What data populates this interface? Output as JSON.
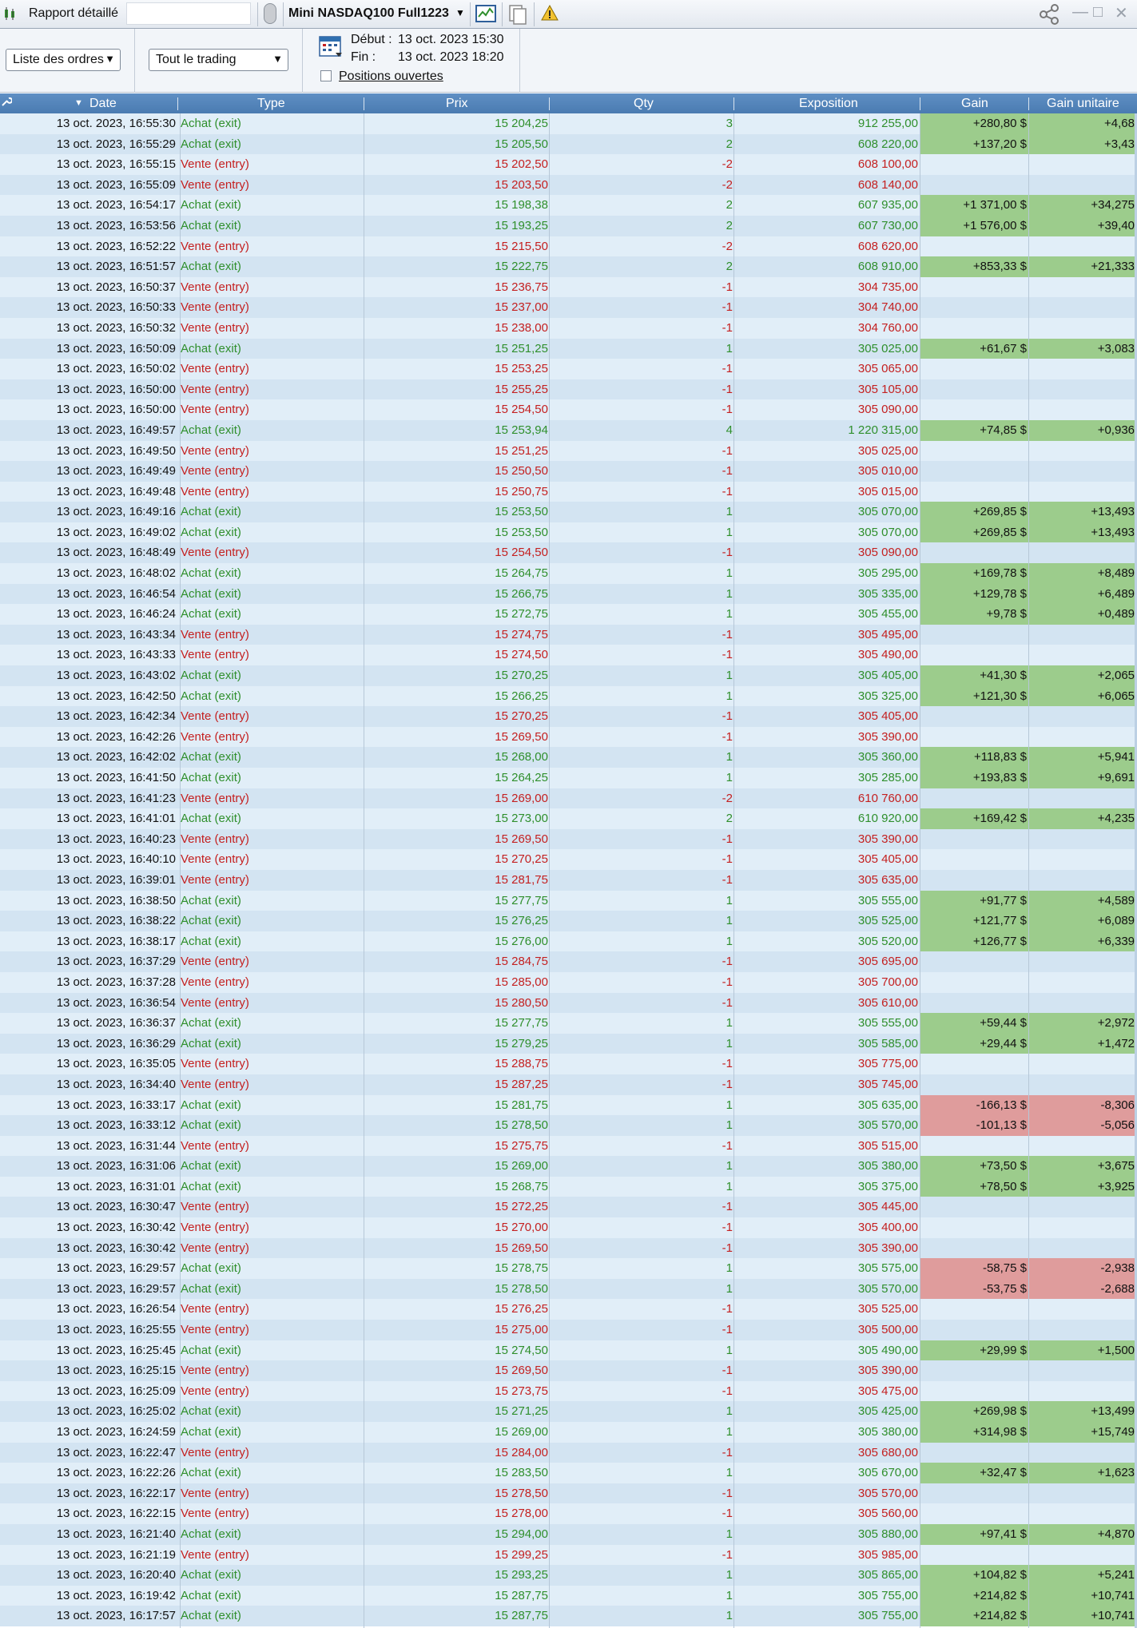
{
  "titlebar": {
    "title": "Rapport détaillé",
    "instrument": "Mini NASDAQ100 Full1223"
  },
  "toolbar": {
    "order_list_select": "Liste des ordres",
    "trading_select": "Tout le trading",
    "start_label": "Début :",
    "start_value": "13 oct. 2023 15:30",
    "end_label": "Fin :",
    "end_value": "13 oct. 2023 18:20",
    "open_positions_label": "Positions ouvertes"
  },
  "colors": {
    "header_bg": "#4a7bb1",
    "buy_text": "#2f8f2c",
    "sell_text": "#c42020",
    "gain_positive_bg": "#9ccc8c",
    "gain_negative_bg": "#df9c9c"
  },
  "table": {
    "columns": [
      "Date",
      "Type",
      "Prix",
      "Qty",
      "Exposition",
      "Gain",
      "Gain unitaire"
    ],
    "rows": [
      [
        "13 oct. 2023, 16:55:30",
        "Achat (exit)",
        "15 204,25",
        "3",
        "912 255,00",
        "+280,80 $",
        "+4,68"
      ],
      [
        "13 oct. 2023, 16:55:29",
        "Achat (exit)",
        "15 205,50",
        "2",
        "608 220,00",
        "+137,20 $",
        "+3,43"
      ],
      [
        "13 oct. 2023, 16:55:15",
        "Vente (entry)",
        "15 202,50",
        "-2",
        "608 100,00",
        "",
        ""
      ],
      [
        "13 oct. 2023, 16:55:09",
        "Vente (entry)",
        "15 203,50",
        "-2",
        "608 140,00",
        "",
        ""
      ],
      [
        "13 oct. 2023, 16:54:17",
        "Achat (exit)",
        "15 198,38",
        "2",
        "607 935,00",
        "+1 371,00 $",
        "+34,275"
      ],
      [
        "13 oct. 2023, 16:53:56",
        "Achat (exit)",
        "15 193,25",
        "2",
        "607 730,00",
        "+1 576,00 $",
        "+39,40"
      ],
      [
        "13 oct. 2023, 16:52:22",
        "Vente (entry)",
        "15 215,50",
        "-2",
        "608 620,00",
        "",
        ""
      ],
      [
        "13 oct. 2023, 16:51:57",
        "Achat (exit)",
        "15 222,75",
        "2",
        "608 910,00",
        "+853,33 $",
        "+21,333"
      ],
      [
        "13 oct. 2023, 16:50:37",
        "Vente (entry)",
        "15 236,75",
        "-1",
        "304 735,00",
        "",
        ""
      ],
      [
        "13 oct. 2023, 16:50:33",
        "Vente (entry)",
        "15 237,00",
        "-1",
        "304 740,00",
        "",
        ""
      ],
      [
        "13 oct. 2023, 16:50:32",
        "Vente (entry)",
        "15 238,00",
        "-1",
        "304 760,00",
        "",
        ""
      ],
      [
        "13 oct. 2023, 16:50:09",
        "Achat (exit)",
        "15 251,25",
        "1",
        "305 025,00",
        "+61,67 $",
        "+3,083"
      ],
      [
        "13 oct. 2023, 16:50:02",
        "Vente (entry)",
        "15 253,25",
        "-1",
        "305 065,00",
        "",
        ""
      ],
      [
        "13 oct. 2023, 16:50:00",
        "Vente (entry)",
        "15 255,25",
        "-1",
        "305 105,00",
        "",
        ""
      ],
      [
        "13 oct. 2023, 16:50:00",
        "Vente (entry)",
        "15 254,50",
        "-1",
        "305 090,00",
        "",
        ""
      ],
      [
        "13 oct. 2023, 16:49:57",
        "Achat (exit)",
        "15 253,94",
        "4",
        "1 220 315,00",
        "+74,85 $",
        "+0,936"
      ],
      [
        "13 oct. 2023, 16:49:50",
        "Vente (entry)",
        "15 251,25",
        "-1",
        "305 025,00",
        "",
        ""
      ],
      [
        "13 oct. 2023, 16:49:49",
        "Vente (entry)",
        "15 250,50",
        "-1",
        "305 010,00",
        "",
        ""
      ],
      [
        "13 oct. 2023, 16:49:48",
        "Vente (entry)",
        "15 250,75",
        "-1",
        "305 015,00",
        "",
        ""
      ],
      [
        "13 oct. 2023, 16:49:16",
        "Achat (exit)",
        "15 253,50",
        "1",
        "305 070,00",
        "+269,85 $",
        "+13,493"
      ],
      [
        "13 oct. 2023, 16:49:02",
        "Achat (exit)",
        "15 253,50",
        "1",
        "305 070,00",
        "+269,85 $",
        "+13,493"
      ],
      [
        "13 oct. 2023, 16:48:49",
        "Vente (entry)",
        "15 254,50",
        "-1",
        "305 090,00",
        "",
        ""
      ],
      [
        "13 oct. 2023, 16:48:02",
        "Achat (exit)",
        "15 264,75",
        "1",
        "305 295,00",
        "+169,78 $",
        "+8,489"
      ],
      [
        "13 oct. 2023, 16:46:54",
        "Achat (exit)",
        "15 266,75",
        "1",
        "305 335,00",
        "+129,78 $",
        "+6,489"
      ],
      [
        "13 oct. 2023, 16:46:24",
        "Achat (exit)",
        "15 272,75",
        "1",
        "305 455,00",
        "+9,78 $",
        "+0,489"
      ],
      [
        "13 oct. 2023, 16:43:34",
        "Vente (entry)",
        "15 274,75",
        "-1",
        "305 495,00",
        "",
        ""
      ],
      [
        "13 oct. 2023, 16:43:33",
        "Vente (entry)",
        "15 274,50",
        "-1",
        "305 490,00",
        "",
        ""
      ],
      [
        "13 oct. 2023, 16:43:02",
        "Achat (exit)",
        "15 270,25",
        "1",
        "305 405,00",
        "+41,30 $",
        "+2,065"
      ],
      [
        "13 oct. 2023, 16:42:50",
        "Achat (exit)",
        "15 266,25",
        "1",
        "305 325,00",
        "+121,30 $",
        "+6,065"
      ],
      [
        "13 oct. 2023, 16:42:34",
        "Vente (entry)",
        "15 270,25",
        "-1",
        "305 405,00",
        "",
        ""
      ],
      [
        "13 oct. 2023, 16:42:26",
        "Vente (entry)",
        "15 269,50",
        "-1",
        "305 390,00",
        "",
        ""
      ],
      [
        "13 oct. 2023, 16:42:02",
        "Achat (exit)",
        "15 268,00",
        "1",
        "305 360,00",
        "+118,83 $",
        "+5,941"
      ],
      [
        "13 oct. 2023, 16:41:50",
        "Achat (exit)",
        "15 264,25",
        "1",
        "305 285,00",
        "+193,83 $",
        "+9,691"
      ],
      [
        "13 oct. 2023, 16:41:23",
        "Vente (entry)",
        "15 269,00",
        "-2",
        "610 760,00",
        "",
        ""
      ],
      [
        "13 oct. 2023, 16:41:01",
        "Achat (exit)",
        "15 273,00",
        "2",
        "610 920,00",
        "+169,42 $",
        "+4,235"
      ],
      [
        "13 oct. 2023, 16:40:23",
        "Vente (entry)",
        "15 269,50",
        "-1",
        "305 390,00",
        "",
        ""
      ],
      [
        "13 oct. 2023, 16:40:10",
        "Vente (entry)",
        "15 270,25",
        "-1",
        "305 405,00",
        "",
        ""
      ],
      [
        "13 oct. 2023, 16:39:01",
        "Vente (entry)",
        "15 281,75",
        "-1",
        "305 635,00",
        "",
        ""
      ],
      [
        "13 oct. 2023, 16:38:50",
        "Achat (exit)",
        "15 277,75",
        "1",
        "305 555,00",
        "+91,77 $",
        "+4,589"
      ],
      [
        "13 oct. 2023, 16:38:22",
        "Achat (exit)",
        "15 276,25",
        "1",
        "305 525,00",
        "+121,77 $",
        "+6,089"
      ],
      [
        "13 oct. 2023, 16:38:17",
        "Achat (exit)",
        "15 276,00",
        "1",
        "305 520,00",
        "+126,77 $",
        "+6,339"
      ],
      [
        "13 oct. 2023, 16:37:29",
        "Vente (entry)",
        "15 284,75",
        "-1",
        "305 695,00",
        "",
        ""
      ],
      [
        "13 oct. 2023, 16:37:28",
        "Vente (entry)",
        "15 285,00",
        "-1",
        "305 700,00",
        "",
        ""
      ],
      [
        "13 oct. 2023, 16:36:54",
        "Vente (entry)",
        "15 280,50",
        "-1",
        "305 610,00",
        "",
        ""
      ],
      [
        "13 oct. 2023, 16:36:37",
        "Achat (exit)",
        "15 277,75",
        "1",
        "305 555,00",
        "+59,44 $",
        "+2,972"
      ],
      [
        "13 oct. 2023, 16:36:29",
        "Achat (exit)",
        "15 279,25",
        "1",
        "305 585,00",
        "+29,44 $",
        "+1,472"
      ],
      [
        "13 oct. 2023, 16:35:05",
        "Vente (entry)",
        "15 288,75",
        "-1",
        "305 775,00",
        "",
        ""
      ],
      [
        "13 oct. 2023, 16:34:40",
        "Vente (entry)",
        "15 287,25",
        "-1",
        "305 745,00",
        "",
        ""
      ],
      [
        "13 oct. 2023, 16:33:17",
        "Achat (exit)",
        "15 281,75",
        "1",
        "305 635,00",
        "-166,13 $",
        "-8,306"
      ],
      [
        "13 oct. 2023, 16:33:12",
        "Achat (exit)",
        "15 278,50",
        "1",
        "305 570,00",
        "-101,13 $",
        "-5,056"
      ],
      [
        "13 oct. 2023, 16:31:44",
        "Vente (entry)",
        "15 275,75",
        "-1",
        "305 515,00",
        "",
        ""
      ],
      [
        "13 oct. 2023, 16:31:06",
        "Achat (exit)",
        "15 269,00",
        "1",
        "305 380,00",
        "+73,50 $",
        "+3,675"
      ],
      [
        "13 oct. 2023, 16:31:01",
        "Achat (exit)",
        "15 268,75",
        "1",
        "305 375,00",
        "+78,50 $",
        "+3,925"
      ],
      [
        "13 oct. 2023, 16:30:47",
        "Vente (entry)",
        "15 272,25",
        "-1",
        "305 445,00",
        "",
        ""
      ],
      [
        "13 oct. 2023, 16:30:42",
        "Vente (entry)",
        "15 270,00",
        "-1",
        "305 400,00",
        "",
        ""
      ],
      [
        "13 oct. 2023, 16:30:42",
        "Vente (entry)",
        "15 269,50",
        "-1",
        "305 390,00",
        "",
        ""
      ],
      [
        "13 oct. 2023, 16:29:57",
        "Achat (exit)",
        "15 278,75",
        "1",
        "305 575,00",
        "-58,75 $",
        "-2,938"
      ],
      [
        "13 oct. 2023, 16:29:57",
        "Achat (exit)",
        "15 278,50",
        "1",
        "305 570,00",
        "-53,75 $",
        "-2,688"
      ],
      [
        "13 oct. 2023, 16:26:54",
        "Vente (entry)",
        "15 276,25",
        "-1",
        "305 525,00",
        "",
        ""
      ],
      [
        "13 oct. 2023, 16:25:55",
        "Vente (entry)",
        "15 275,00",
        "-1",
        "305 500,00",
        "",
        ""
      ],
      [
        "13 oct. 2023, 16:25:45",
        "Achat (exit)",
        "15 274,50",
        "1",
        "305 490,00",
        "+29,99 $",
        "+1,500"
      ],
      [
        "13 oct. 2023, 16:25:15",
        "Vente (entry)",
        "15 269,50",
        "-1",
        "305 390,00",
        "",
        ""
      ],
      [
        "13 oct. 2023, 16:25:09",
        "Vente (entry)",
        "15 273,75",
        "-1",
        "305 475,00",
        "",
        ""
      ],
      [
        "13 oct. 2023, 16:25:02",
        "Achat (exit)",
        "15 271,25",
        "1",
        "305 425,00",
        "+269,98 $",
        "+13,499"
      ],
      [
        "13 oct. 2023, 16:24:59",
        "Achat (exit)",
        "15 269,00",
        "1",
        "305 380,00",
        "+314,98 $",
        "+15,749"
      ],
      [
        "13 oct. 2023, 16:22:47",
        "Vente (entry)",
        "15 284,00",
        "-1",
        "305 680,00",
        "",
        ""
      ],
      [
        "13 oct. 2023, 16:22:26",
        "Achat (exit)",
        "15 283,50",
        "1",
        "305 670,00",
        "+32,47 $",
        "+1,623"
      ],
      [
        "13 oct. 2023, 16:22:17",
        "Vente (entry)",
        "15 278,50",
        "-1",
        "305 570,00",
        "",
        ""
      ],
      [
        "13 oct. 2023, 16:22:15",
        "Vente (entry)",
        "15 278,00",
        "-1",
        "305 560,00",
        "",
        ""
      ],
      [
        "13 oct. 2023, 16:21:40",
        "Achat (exit)",
        "15 294,00",
        "1",
        "305 880,00",
        "+97,41 $",
        "+4,870"
      ],
      [
        "13 oct. 2023, 16:21:19",
        "Vente (entry)",
        "15 299,25",
        "-1",
        "305 985,00",
        "",
        ""
      ],
      [
        "13 oct. 2023, 16:20:40",
        "Achat (exit)",
        "15 293,25",
        "1",
        "305 865,00",
        "+104,82 $",
        "+5,241"
      ],
      [
        "13 oct. 2023, 16:19:42",
        "Achat (exit)",
        "15 287,75",
        "1",
        "305 755,00",
        "+214,82 $",
        "+10,741"
      ],
      [
        "13 oct. 2023, 16:17:57",
        "Achat (exit)",
        "15 287,75",
        "1",
        "305 755,00",
        "+214,82 $",
        "+10,741"
      ]
    ]
  }
}
